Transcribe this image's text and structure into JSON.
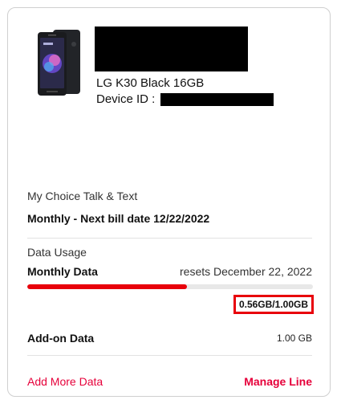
{
  "device": {
    "image_icon": "phone-image",
    "model": "LG K30 Black 16GB",
    "id_label": "Device ID :"
  },
  "plan": {
    "name": "My Choice Talk & Text",
    "bill_info": "Monthly - Next bill date 12/22/2022"
  },
  "data_usage": {
    "title": "Data Usage",
    "monthly_label": "Monthly Data",
    "resets_text": "resets December 22, 2022",
    "used_fraction": 0.56,
    "amount": "0.56GB/1.00GB"
  },
  "addon": {
    "label": "Add-on Data",
    "value": "1.00 GB"
  },
  "actions": {
    "add_more": "Add More Data",
    "manage_line": "Manage Line"
  },
  "colors": {
    "accent": "#e6003a",
    "progress": "#e8000b",
    "highlight_box": "#e8000b"
  }
}
